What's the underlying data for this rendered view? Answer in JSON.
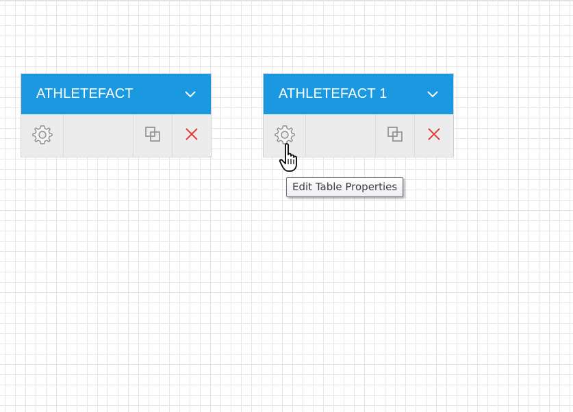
{
  "tables": [
    {
      "title": "ATHLETEFACT",
      "icons": {
        "expand": "chevron-down-icon",
        "settings": "gear-icon",
        "copy": "copy-icon",
        "delete": "close-icon"
      }
    },
    {
      "title": "ATHLETEFACT 1",
      "icons": {
        "expand": "chevron-down-icon",
        "settings": "gear-icon",
        "copy": "copy-icon",
        "delete": "close-icon"
      }
    }
  ],
  "tooltip": {
    "text": "Edit Table Properties"
  },
  "cursor": {
    "icon": "hand-pointer-icon"
  },
  "colors": {
    "header_bg": "#1a98e0",
    "toolbar_bg": "#ececec",
    "delete_icon": "#e53935",
    "icon_gray": "#8c8c8c",
    "grid_line": "#e6e6e6"
  }
}
